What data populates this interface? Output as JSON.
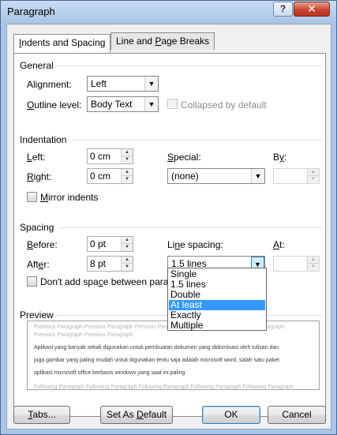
{
  "window": {
    "title": "Paragraph",
    "help_label": "?",
    "close_label": "✕"
  },
  "tabs": [
    {
      "label": "Indents and Spacing",
      "underline": "I",
      "rest": "ndents and Spacing",
      "active": true
    },
    {
      "label": "Line and Page Breaks",
      "pre": "Line and ",
      "underline": "P",
      "rest": "age Breaks",
      "active": false
    }
  ],
  "general": {
    "heading": "General",
    "alignment_label_pre": "Ali",
    "alignment_label_ul": "g",
    "alignment_label_post": "nment:",
    "alignment_value": "Left",
    "outline_label_ul": "O",
    "outline_label_post": "utline level:",
    "outline_value": "Body Text",
    "collapsed_label": "Collapsed by default"
  },
  "indentation": {
    "heading": "Indentation",
    "left_label_ul": "L",
    "left_label_post": "eft:",
    "left_value": "0 cm",
    "right_label_ul": "R",
    "right_label_post": "ight:",
    "right_value": "0 cm",
    "special_label_ul": "S",
    "special_label_post": "pecial:",
    "special_value": "(none)",
    "by_label_pre": "B",
    "by_label_ul": "y",
    "by_label_post": ":",
    "by_value": "",
    "mirror_label_ul": "M",
    "mirror_label_post": "irror indents"
  },
  "spacing": {
    "heading": "Spacing",
    "before_label_ul": "B",
    "before_label_post": "efore:",
    "before_value": "0 pt",
    "after_label_pre": "Aft",
    "after_label_ul": "e",
    "after_label_post": "r:",
    "after_value": "8 pt",
    "line_spacing_label_pre": "Li",
    "line_spacing_label_ul": "n",
    "line_spacing_label_post": "e spacing:",
    "line_spacing_value": "1.5 lines",
    "at_label_ul": "A",
    "at_label_post": "t:",
    "at_value": "",
    "dont_add_label_pre": "Don't add spa",
    "dont_add_label_ul": "c",
    "dont_add_label_post": "e between parag"
  },
  "line_spacing_options": [
    "Single",
    "1.5 lines",
    "Double",
    "At least",
    "Exactly",
    "Multiple"
  ],
  "line_spacing_selected_index": 3,
  "preview": {
    "heading": "Preview",
    "prev_para": "Previous Paragraph Previous Paragraph Previous Paragraph Previous Paragraph Previous Paragraph",
    "prev_para2": "Previous Paragraph Previous Paragraph",
    "body_line1": "Aplikasi yang banyak sekali digunakan untuk pembuatan dokumen yang didominasi oleh tulisan dan",
    "body_line2": "juga gambar yang paling mudah untuk digunakan tentu saja adalah microsoft word, salah satu paket",
    "body_line3": "aplikasi microsoft office berbasis windows yang saat ini paling",
    "next_para": "Following Paragraph Following Paragraph Following Paragraph Following Paragraph Following Paragraph"
  },
  "buttons": {
    "tabs_ul": "T",
    "tabs_post": "abs...",
    "default_pre": "Set As ",
    "default_ul": "D",
    "default_post": "efault",
    "ok": "OK",
    "cancel": "Cancel"
  }
}
